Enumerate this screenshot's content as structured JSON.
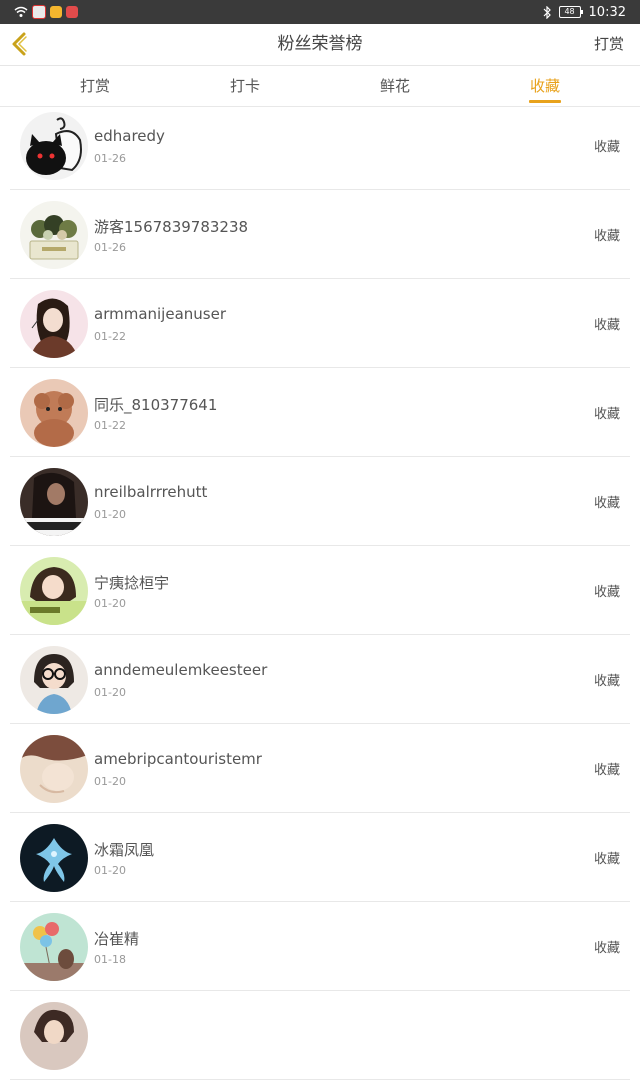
{
  "status_bar": {
    "time": "10:32",
    "battery": "48"
  },
  "header": {
    "title": "粉丝荣誉榜",
    "action": "打赏"
  },
  "tabs": [
    {
      "label": "打赏"
    },
    {
      "label": "打卡"
    },
    {
      "label": "鲜花"
    },
    {
      "label": "收藏"
    }
  ],
  "active_tab": "收藏",
  "accent_color": "#e8a21c",
  "rows": [
    {
      "name": "edharedy",
      "date": "01-26",
      "action": "收藏"
    },
    {
      "name": "游客1567839783238",
      "date": "01-26",
      "action": "收藏"
    },
    {
      "name": "armmanijeanuser",
      "date": "01-22",
      "action": "收藏"
    },
    {
      "name": "同乐_810377641",
      "date": "01-22",
      "action": "收藏"
    },
    {
      "name": "nreilbalrrrehutt",
      "date": "01-20",
      "action": "收藏"
    },
    {
      "name": "宁痍捻桓宇",
      "date": "01-20",
      "action": "收藏"
    },
    {
      "name": "anndemeulemkeesteer",
      "date": "01-20",
      "action": "收藏"
    },
    {
      "name": "amebripcantouristemr",
      "date": "01-20",
      "action": "收藏"
    },
    {
      "name": "冰霜凤凰",
      "date": "01-20",
      "action": "收藏"
    },
    {
      "name": "冶崔精",
      "date": "01-18",
      "action": "收藏"
    }
  ]
}
